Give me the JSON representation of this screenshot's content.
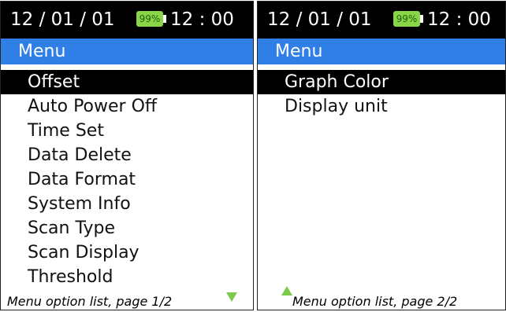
{
  "colors": {
    "status_bar_bg": "#000000",
    "title_bar_bg": "#2f7fe6",
    "selection_bg": "#000000",
    "battery_green": "#8ad448",
    "scroll_arrow": "#7ccb4b"
  },
  "screens": [
    {
      "status": {
        "date": "12 / 01 / 01",
        "battery": "99%",
        "time": "12 : 00"
      },
      "title": "Menu",
      "items": [
        "Offset",
        "Auto Power Off",
        "Time Set",
        "Data Delete",
        "Data Format",
        "System Info",
        "Scan Type",
        "Scan Display",
        "Threshold"
      ],
      "selected_index": 0,
      "caption": "Menu option list, page 1/2",
      "scroll_icon": "chevron-down-icon"
    },
    {
      "status": {
        "date": "12 / 01 / 01",
        "battery": "99%",
        "time": "12 : 00"
      },
      "title": "Menu",
      "items": [
        "Graph Color",
        "Display unit"
      ],
      "selected_index": 0,
      "caption": "Menu option list, page 2/2",
      "scroll_icon": "chevron-up-icon"
    }
  ]
}
